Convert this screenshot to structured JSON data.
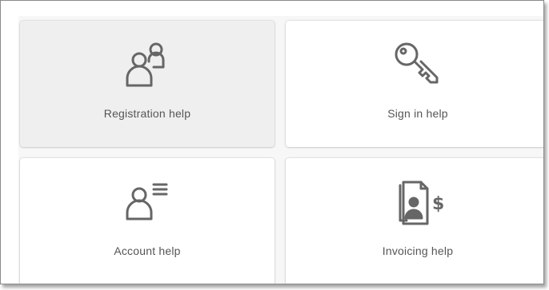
{
  "tiles": [
    {
      "label": "Registration help",
      "icon": "users-icon"
    },
    {
      "label": "Sign in help",
      "icon": "key-icon"
    },
    {
      "label": "Account help",
      "icon": "account-details-icon"
    },
    {
      "label": "Invoicing help",
      "icon": "invoice-icon"
    }
  ],
  "colors": {
    "icon": "#666666",
    "label": "#555555",
    "tile_bg": "#ffffff",
    "tile_hover_bg": "#efefef",
    "panel_bg": "#f7f7f7"
  }
}
